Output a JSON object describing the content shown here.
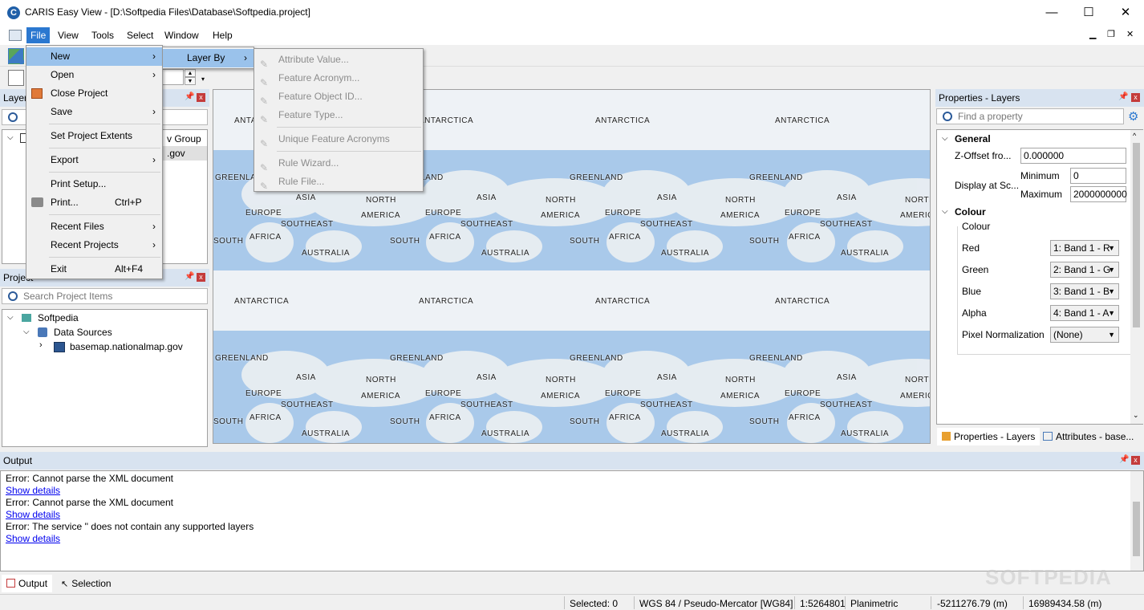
{
  "window": {
    "title": "CARIS Easy View - [D:\\Softpedia Files\\Database\\Softpedia.project]",
    "minimize": "—",
    "maximize": "☐",
    "close": "✕"
  },
  "menubar": {
    "items": [
      "File",
      "View",
      "Tools",
      "Select",
      "Window",
      "Help"
    ],
    "active": "File",
    "mdi": {
      "minimize": "▁",
      "restore": "❐",
      "close": "✕"
    }
  },
  "file_menu": {
    "items": [
      {
        "label": "New",
        "has_sub": true
      },
      {
        "label": "Open",
        "has_sub": true
      },
      {
        "label": "Close Project"
      },
      {
        "label": "Save",
        "has_sub": true
      },
      {
        "label": "Set Project Extents"
      },
      {
        "label": "Export",
        "has_sub": true
      },
      {
        "label": "Print Setup..."
      },
      {
        "label": "Print...",
        "shortcut": "Ctrl+P"
      },
      {
        "label": "Recent Files",
        "has_sub": true
      },
      {
        "label": "Recent Projects",
        "has_sub": true
      },
      {
        "label": "Exit",
        "shortcut": "Alt+F4"
      }
    ],
    "arrow": "›"
  },
  "new_submenu": {
    "items": [
      {
        "label": "Layer By"
      }
    ]
  },
  "layerby_submenu": {
    "items": [
      "Attribute Value...",
      "Feature Acronym...",
      "Feature Object ID...",
      "Feature Type...",
      "Unique Feature Acronyms",
      "Rule Wizard...",
      "Rule File..."
    ]
  },
  "layers_panel": {
    "title": "Layer",
    "partial_row1": "v Group",
    "partial_row2": ".gov"
  },
  "toolbar": {
    "stepper_value": ""
  },
  "project_panel": {
    "title": "Project",
    "search_placeholder": "Search Project Items",
    "tree": {
      "root": "Softpedia",
      "child": "Data Sources",
      "leaf": "basemap.nationalmap.gov"
    }
  },
  "map": {
    "labels": {
      "antarctica": "ANTARCTICA",
      "greenland": "GREENLAND",
      "asia": "ASIA",
      "north": "NORTH",
      "america": "AMERICA",
      "europe": "EUROPE",
      "southeast": "SOUTHEAST",
      "africa": "AFRICA",
      "south": "SOUTH",
      "australia": "AUSTRALIA"
    }
  },
  "properties_panel": {
    "title": "Properties - Layers",
    "search_placeholder": "Find a property",
    "general": {
      "heading": "General",
      "z_offset_label": "Z-Offset fro...",
      "z_offset_value": "0.000000",
      "display_label": "Display at Sc...",
      "minimum_label": "Minimum",
      "minimum_value": "0",
      "maximum_label": "Maximum",
      "maximum_value": "2000000000"
    },
    "colour": {
      "heading": "Colour",
      "group_label": "Colour",
      "red_label": "Red",
      "red_value": "1: Band 1 - R",
      "green_label": "Green",
      "green_value": "2: Band 1 - G",
      "blue_label": "Blue",
      "blue_value": "3: Band 1 - B",
      "alpha_label": "Alpha",
      "alpha_value": "4: Band 1 - A",
      "pixel_label": "Pixel Normalization",
      "pixel_value": "(None)"
    },
    "tabs": [
      "Properties - Layers",
      "Attributes - base..."
    ]
  },
  "output_panel": {
    "title": "Output",
    "lines": [
      "Error: Cannot parse the XML document",
      "Show details",
      "Error: Cannot parse the XML document",
      "Show details",
      "Error: The service '' does not contain any supported layers",
      "Show details"
    ],
    "tabs": [
      "Output",
      "Selection"
    ]
  },
  "statusbar": {
    "selected": "Selected: 0",
    "crs": "WGS 84 / Pseudo-Mercator [WG84]",
    "scale": "1:5264801",
    "mode": "Planimetric",
    "x": "-5211276.79 (m)",
    "y": "16989434.58 (m)"
  },
  "watermark": "SOFTPEDIA",
  "colors": {
    "accent": "#2b78d0",
    "highlight": "#9ac2eb",
    "panel_header": "#d8e3f0",
    "map_land": "#e6eef4",
    "map_water": "#9fc3e6"
  }
}
